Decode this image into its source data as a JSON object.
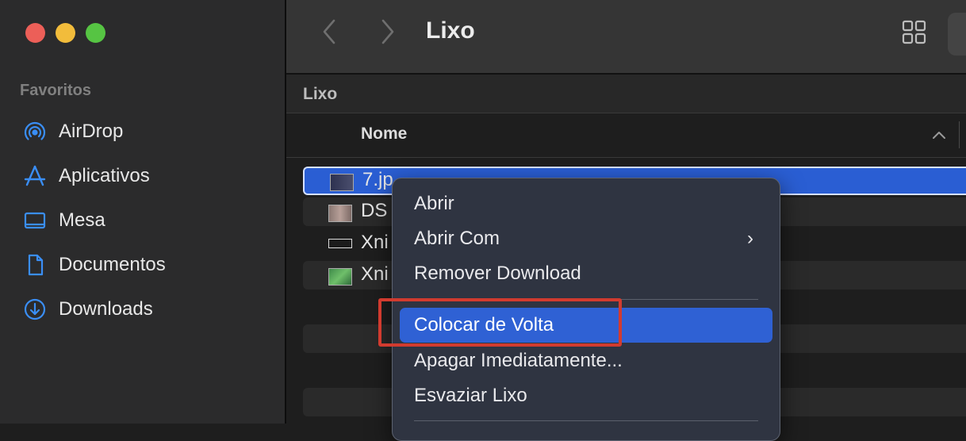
{
  "window": {
    "title": "Lixo"
  },
  "sidebar": {
    "section_title": "Favoritos",
    "items": [
      {
        "label": "AirDrop",
        "icon": "airdrop-icon"
      },
      {
        "label": "Aplicativos",
        "icon": "applications-icon"
      },
      {
        "label": "Mesa",
        "icon": "desktop-icon"
      },
      {
        "label": "Documentos",
        "icon": "document-icon"
      },
      {
        "label": "Downloads",
        "icon": "download-icon"
      }
    ]
  },
  "content": {
    "path_label": "Lixo",
    "column_header": "Nome",
    "files": [
      {
        "name": "7.jp",
        "selected": true
      },
      {
        "name": "DS"
      },
      {
        "name": "Xni"
      },
      {
        "name": "Xni"
      }
    ]
  },
  "context_menu": {
    "items": [
      {
        "label": "Abrir"
      },
      {
        "label": "Abrir Com",
        "submenu_arrow": "›"
      },
      {
        "label": "Remover Download"
      },
      {
        "label": "Colocar de Volta",
        "highlighted": true
      },
      {
        "label": "Apagar Imediatamente..."
      },
      {
        "label": "Esvaziar Lixo"
      }
    ]
  },
  "colors": {
    "accent": "#2f61d4",
    "annotation": "#d23b2f",
    "sidebar_icon": "#3a8ef6"
  }
}
